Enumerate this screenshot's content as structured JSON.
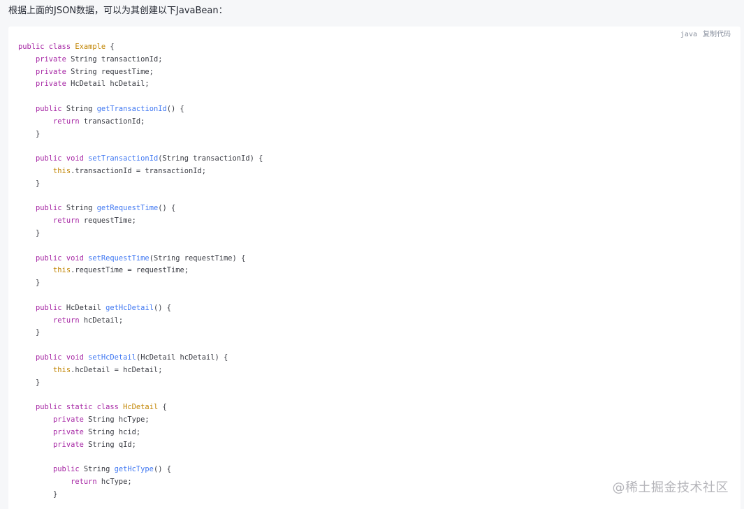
{
  "intro_text": "根据上面的JSON数据，可以为其创建以下JavaBean：",
  "code_block": {
    "language": "java",
    "copy_label": "复制代码",
    "lines": [
      [
        {
          "t": "kw",
          "v": "public class "
        },
        {
          "t": "cls",
          "v": "Example"
        },
        {
          "t": "plain",
          "v": " {"
        }
      ],
      [
        {
          "t": "plain",
          "v": "    "
        },
        {
          "t": "kw",
          "v": "private"
        },
        {
          "t": "plain",
          "v": " String transactionId;"
        }
      ],
      [
        {
          "t": "plain",
          "v": "    "
        },
        {
          "t": "kw",
          "v": "private"
        },
        {
          "t": "plain",
          "v": " String requestTime;"
        }
      ],
      [
        {
          "t": "plain",
          "v": "    "
        },
        {
          "t": "kw",
          "v": "private"
        },
        {
          "t": "plain",
          "v": " HcDetail hcDetail;"
        }
      ],
      [
        {
          "t": "plain",
          "v": ""
        }
      ],
      [
        {
          "t": "plain",
          "v": "    "
        },
        {
          "t": "kw",
          "v": "public"
        },
        {
          "t": "plain",
          "v": " String "
        },
        {
          "t": "fn",
          "v": "getTransactionId"
        },
        {
          "t": "plain",
          "v": "() {"
        }
      ],
      [
        {
          "t": "plain",
          "v": "        "
        },
        {
          "t": "kw",
          "v": "return"
        },
        {
          "t": "plain",
          "v": " transactionId;"
        }
      ],
      [
        {
          "t": "plain",
          "v": "    }"
        }
      ],
      [
        {
          "t": "plain",
          "v": ""
        }
      ],
      [
        {
          "t": "plain",
          "v": "    "
        },
        {
          "t": "kw",
          "v": "public void "
        },
        {
          "t": "fn",
          "v": "setTransactionId"
        },
        {
          "t": "plain",
          "v": "(String transactionId) {"
        }
      ],
      [
        {
          "t": "plain",
          "v": "        "
        },
        {
          "t": "this",
          "v": "this"
        },
        {
          "t": "plain",
          "v": ".transactionId = transactionId;"
        }
      ],
      [
        {
          "t": "plain",
          "v": "    }"
        }
      ],
      [
        {
          "t": "plain",
          "v": ""
        }
      ],
      [
        {
          "t": "plain",
          "v": "    "
        },
        {
          "t": "kw",
          "v": "public"
        },
        {
          "t": "plain",
          "v": " String "
        },
        {
          "t": "fn",
          "v": "getRequestTime"
        },
        {
          "t": "plain",
          "v": "() {"
        }
      ],
      [
        {
          "t": "plain",
          "v": "        "
        },
        {
          "t": "kw",
          "v": "return"
        },
        {
          "t": "plain",
          "v": " requestTime;"
        }
      ],
      [
        {
          "t": "plain",
          "v": "    }"
        }
      ],
      [
        {
          "t": "plain",
          "v": ""
        }
      ],
      [
        {
          "t": "plain",
          "v": "    "
        },
        {
          "t": "kw",
          "v": "public void "
        },
        {
          "t": "fn",
          "v": "setRequestTime"
        },
        {
          "t": "plain",
          "v": "(String requestTime) {"
        }
      ],
      [
        {
          "t": "plain",
          "v": "        "
        },
        {
          "t": "this",
          "v": "this"
        },
        {
          "t": "plain",
          "v": ".requestTime = requestTime;"
        }
      ],
      [
        {
          "t": "plain",
          "v": "    }"
        }
      ],
      [
        {
          "t": "plain",
          "v": ""
        }
      ],
      [
        {
          "t": "plain",
          "v": "    "
        },
        {
          "t": "kw",
          "v": "public"
        },
        {
          "t": "plain",
          "v": " HcDetail "
        },
        {
          "t": "fn",
          "v": "getHcDetail"
        },
        {
          "t": "plain",
          "v": "() {"
        }
      ],
      [
        {
          "t": "plain",
          "v": "        "
        },
        {
          "t": "kw",
          "v": "return"
        },
        {
          "t": "plain",
          "v": " hcDetail;"
        }
      ],
      [
        {
          "t": "plain",
          "v": "    }"
        }
      ],
      [
        {
          "t": "plain",
          "v": ""
        }
      ],
      [
        {
          "t": "plain",
          "v": "    "
        },
        {
          "t": "kw",
          "v": "public void "
        },
        {
          "t": "fn",
          "v": "setHcDetail"
        },
        {
          "t": "plain",
          "v": "(HcDetail hcDetail) {"
        }
      ],
      [
        {
          "t": "plain",
          "v": "        "
        },
        {
          "t": "this",
          "v": "this"
        },
        {
          "t": "plain",
          "v": ".hcDetail = hcDetail;"
        }
      ],
      [
        {
          "t": "plain",
          "v": "    }"
        }
      ],
      [
        {
          "t": "plain",
          "v": ""
        }
      ],
      [
        {
          "t": "plain",
          "v": "    "
        },
        {
          "t": "kw",
          "v": "public static class "
        },
        {
          "t": "cls",
          "v": "HcDetail"
        },
        {
          "t": "plain",
          "v": " {"
        }
      ],
      [
        {
          "t": "plain",
          "v": "        "
        },
        {
          "t": "kw",
          "v": "private"
        },
        {
          "t": "plain",
          "v": " String hcType;"
        }
      ],
      [
        {
          "t": "plain",
          "v": "        "
        },
        {
          "t": "kw",
          "v": "private"
        },
        {
          "t": "plain",
          "v": " String hcid;"
        }
      ],
      [
        {
          "t": "plain",
          "v": "        "
        },
        {
          "t": "kw",
          "v": "private"
        },
        {
          "t": "plain",
          "v": " String qId;"
        }
      ],
      [
        {
          "t": "plain",
          "v": ""
        }
      ],
      [
        {
          "t": "plain",
          "v": "        "
        },
        {
          "t": "kw",
          "v": "public"
        },
        {
          "t": "plain",
          "v": " String "
        },
        {
          "t": "fn",
          "v": "getHcType"
        },
        {
          "t": "plain",
          "v": "() {"
        }
      ],
      [
        {
          "t": "plain",
          "v": "            "
        },
        {
          "t": "kw",
          "v": "return"
        },
        {
          "t": "plain",
          "v": " hcType;"
        }
      ],
      [
        {
          "t": "plain",
          "v": "        }"
        }
      ]
    ]
  },
  "watermark": "@稀土掘金技术社区",
  "colors": {
    "keyword": "#a626a4",
    "class_name": "#c18401",
    "function_name": "#4078f2",
    "plain": "#383a42",
    "page_bg": "#f6f7f9",
    "code_bg": "#ffffff"
  }
}
